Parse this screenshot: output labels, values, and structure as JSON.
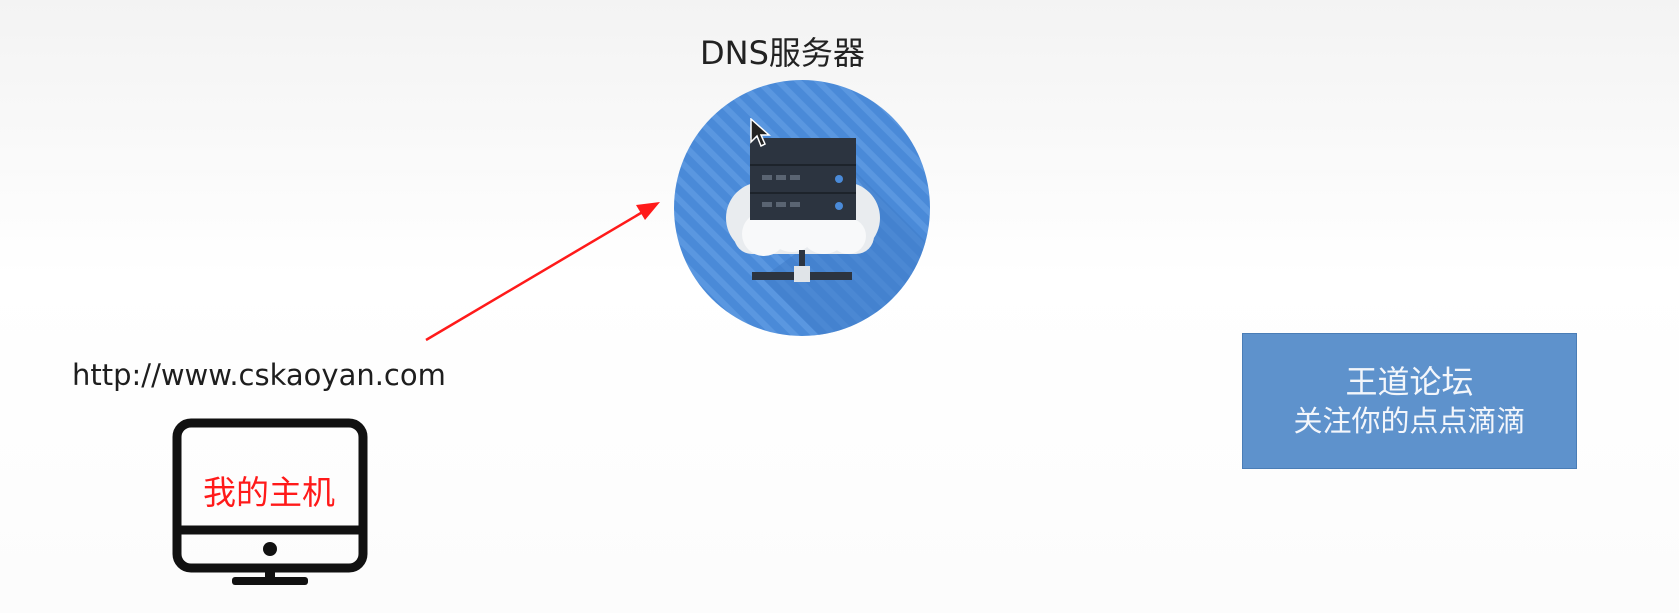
{
  "dns_server": {
    "label": "DNS服务器",
    "icon": "cloud-server-icon",
    "circle_color": "#4a8ad8"
  },
  "client": {
    "url": "http://www.cskaoyan.com",
    "host_label": "我的主机",
    "icon": "desktop-monitor-icon",
    "label_color": "#ff1a1a"
  },
  "arrow": {
    "color": "#ff1a1a",
    "from": "client",
    "to": "dns_server"
  },
  "forum_badge": {
    "title": "王道论坛",
    "subtitle": "关注你的点点滴滴",
    "background": "#5e92cc"
  }
}
